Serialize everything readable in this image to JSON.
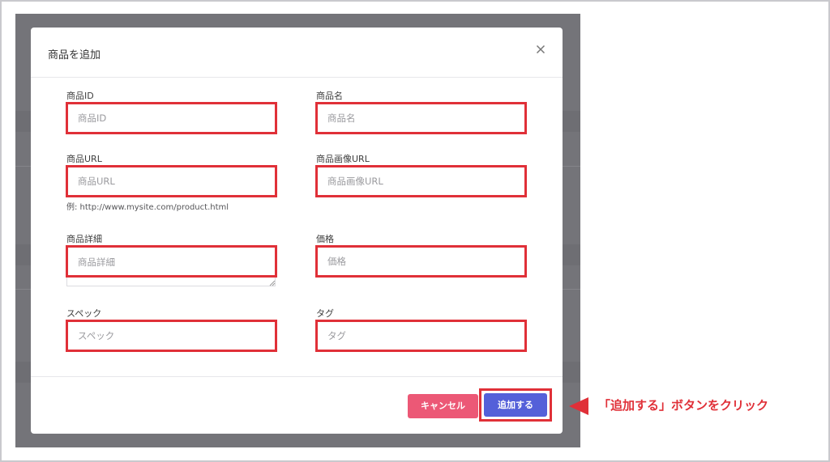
{
  "modal": {
    "title": "商品を追加",
    "close_icon": "close-icon"
  },
  "fields": {
    "product_id": {
      "label": "商品ID",
      "placeholder": "商品ID"
    },
    "product_name": {
      "label": "商品名",
      "placeholder": "商品名"
    },
    "product_url": {
      "label": "商品URL",
      "placeholder": "商品URL",
      "helper": "例: http://www.mysite.com/product.html"
    },
    "product_image_url": {
      "label": "商品画像URL",
      "placeholder": "商品画像URL"
    },
    "product_detail": {
      "label": "商品詳細",
      "placeholder": "商品詳細"
    },
    "price": {
      "label": "価格",
      "placeholder": "価格"
    },
    "spec": {
      "label": "スペック",
      "placeholder": "スペック"
    },
    "tag": {
      "label": "タグ",
      "placeholder": "タグ"
    }
  },
  "footer": {
    "cancel_label": "キャンセル",
    "add_label": "追加する"
  },
  "annotation": {
    "text": "「追加する」ボタンをクリック"
  },
  "colors": {
    "highlight": "#e03038",
    "cancel": "#ec5876",
    "primary": "#5460d9",
    "backdrop": "#747479"
  }
}
